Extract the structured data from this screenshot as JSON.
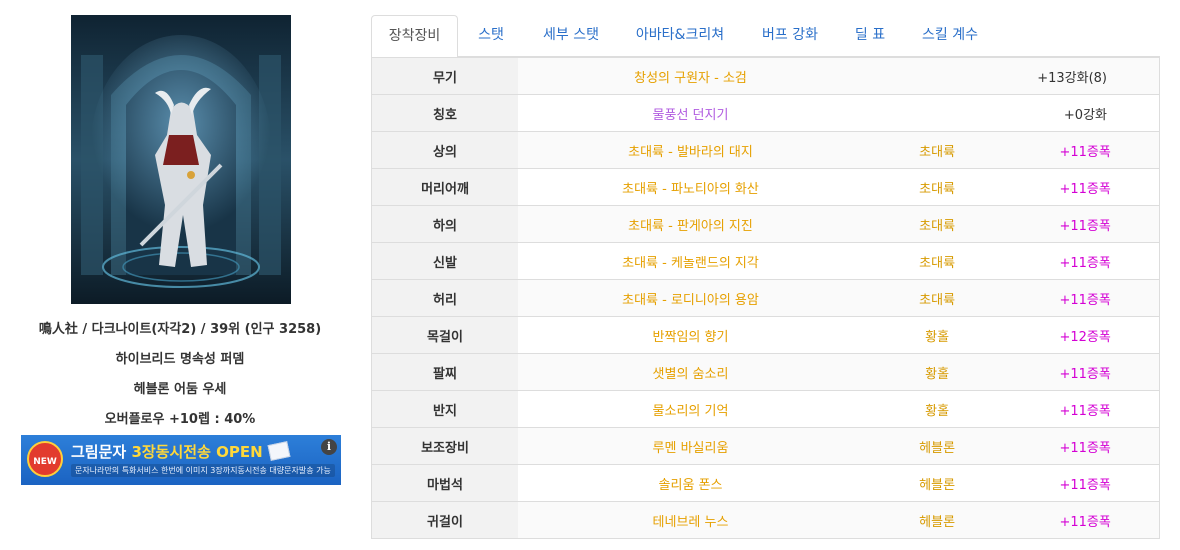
{
  "profile": {
    "line1": "鳴人社 / 다크나이트(자각2) / 39위 (인구 3258)",
    "line2": "하이브리드 명속성 퍼뎀",
    "line3": "헤블론 어둠 우세",
    "line4": "오버플로우 +10렙 : 40%"
  },
  "banner": {
    "badge": "NEW",
    "title_prefix": "그림문자",
    "title_highlight": "3장동시전송 OPEN",
    "subtitle": "문자나라만의 특화서비스 한번에 이미지 3장까지동시전송 대량문자발송 가능",
    "info_glyph": "i"
  },
  "tabs": [
    "장착장비",
    "스탯",
    "세부 스탯",
    "아바타&크리쳐",
    "버프 강화",
    "딜 표",
    "스킬 계수"
  ],
  "colors": {
    "epic": "#e6a000",
    "rare": "#b05be0",
    "amplify": "#d400d4",
    "tab_link": "#2a6fc9"
  },
  "equipment": [
    {
      "slot": "무기",
      "name": "창성의 구원자 - 소검",
      "set": "",
      "enh": "+13강화(8)",
      "name_color": "epic",
      "enh_color": "dark"
    },
    {
      "slot": "칭호",
      "name": "물풍선 던지기",
      "set": "",
      "enh": "+0강화",
      "name_color": "rare",
      "enh_color": "dark"
    },
    {
      "slot": "상의",
      "name": "초대륙 - 발바라의 대지",
      "set": "초대륙",
      "enh": "+11증폭",
      "name_color": "epic",
      "enh_color": "amp"
    },
    {
      "slot": "머리어깨",
      "name": "초대륙 - 파노티아의 화산",
      "set": "초대륙",
      "enh": "+11증폭",
      "name_color": "epic",
      "enh_color": "amp"
    },
    {
      "slot": "하의",
      "name": "초대륙 - 판게아의 지진",
      "set": "초대륙",
      "enh": "+11증폭",
      "name_color": "epic",
      "enh_color": "amp"
    },
    {
      "slot": "신발",
      "name": "초대륙 - 케놀랜드의 지각",
      "set": "초대륙",
      "enh": "+11증폭",
      "name_color": "epic",
      "enh_color": "amp"
    },
    {
      "slot": "허리",
      "name": "초대륙 - 로디니아의 용암",
      "set": "초대륙",
      "enh": "+11증폭",
      "name_color": "epic",
      "enh_color": "amp"
    },
    {
      "slot": "목걸이",
      "name": "반짝임의 향기",
      "set": "황홀",
      "enh": "+12증폭",
      "name_color": "epic",
      "enh_color": "amp"
    },
    {
      "slot": "팔찌",
      "name": "샛별의 숨소리",
      "set": "황홀",
      "enh": "+11증폭",
      "name_color": "epic",
      "enh_color": "amp"
    },
    {
      "slot": "반지",
      "name": "물소리의 기억",
      "set": "황홀",
      "enh": "+11증폭",
      "name_color": "epic",
      "enh_color": "amp"
    },
    {
      "slot": "보조장비",
      "name": "루멘 바실리움",
      "set": "헤블론",
      "enh": "+11증폭",
      "name_color": "epic",
      "enh_color": "amp"
    },
    {
      "slot": "마법석",
      "name": "솔리움 폰스",
      "set": "헤블론",
      "enh": "+11증폭",
      "name_color": "epic",
      "enh_color": "amp"
    },
    {
      "slot": "귀걸이",
      "name": "테네브레 누스",
      "set": "헤블론",
      "enh": "+11증폭",
      "name_color": "epic",
      "enh_color": "amp"
    }
  ]
}
